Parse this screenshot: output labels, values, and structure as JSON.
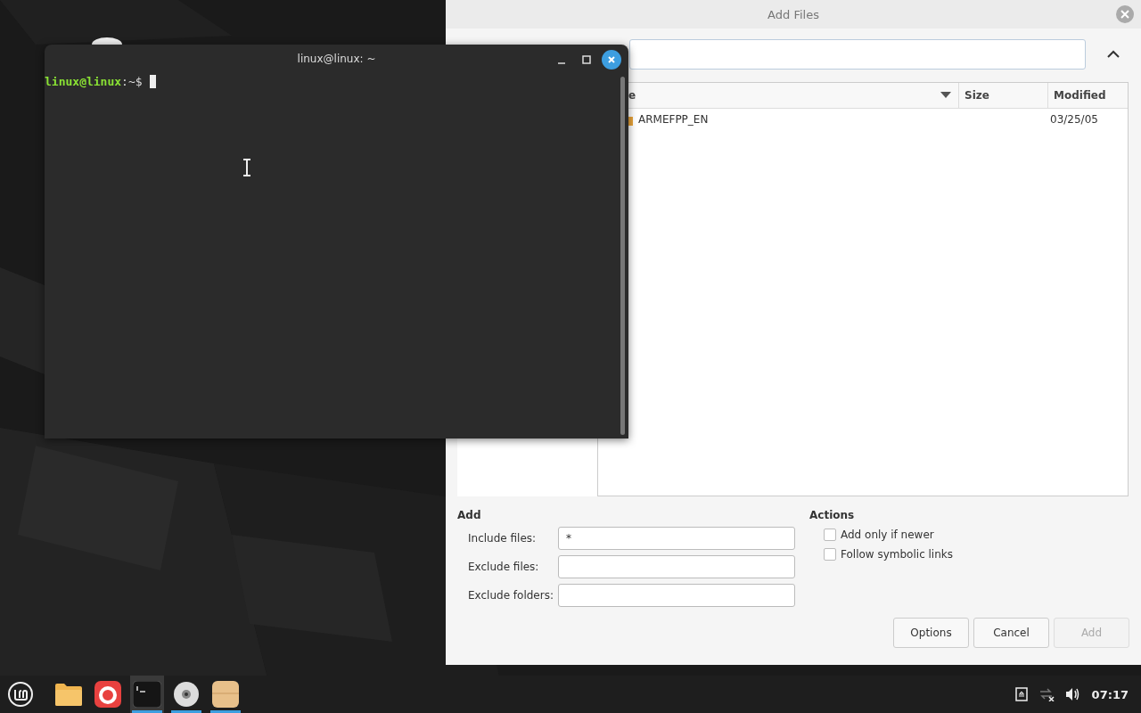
{
  "terminal": {
    "title": "linux@linux: ~",
    "prompt_user": "linux@linux",
    "prompt_path": ":~$"
  },
  "dialog": {
    "title": "Add Files",
    "file_list": {
      "columns": [
        "e",
        "Size",
        "Modified"
      ],
      "rows": [
        {
          "name": "ARMEFPP_EN",
          "modified": "03/25/05",
          "selected": false
        }
      ]
    },
    "add_section": {
      "heading": "Add",
      "fields": [
        {
          "label": "Include files:",
          "value": "*"
        },
        {
          "label": "Exclude files:"
        },
        {
          "label": "Exclude folders:"
        }
      ]
    },
    "actions_section": {
      "heading": "Actions",
      "options": [
        {
          "label": "Add only if newer",
          "checked": false
        },
        {
          "label": "Follow symbolic links",
          "checked": false
        }
      ]
    },
    "buttons": [
      {
        "label": "Options",
        "disabled": false
      },
      {
        "label": "Cancel",
        "disabled": false
      },
      {
        "label": "Add",
        "disabled": true
      }
    ]
  },
  "taskbar": {
    "apps": [
      {
        "kind": "folder",
        "running": false,
        "selected": false
      },
      {
        "kind": "browser",
        "running": false,
        "selected": false
      },
      {
        "kind": "terminal",
        "running": true,
        "selected": true
      },
      {
        "kind": "disc",
        "running": true,
        "selected": false
      },
      {
        "kind": "archive",
        "running": true,
        "selected": false
      }
    ],
    "clock": "07:17"
  }
}
